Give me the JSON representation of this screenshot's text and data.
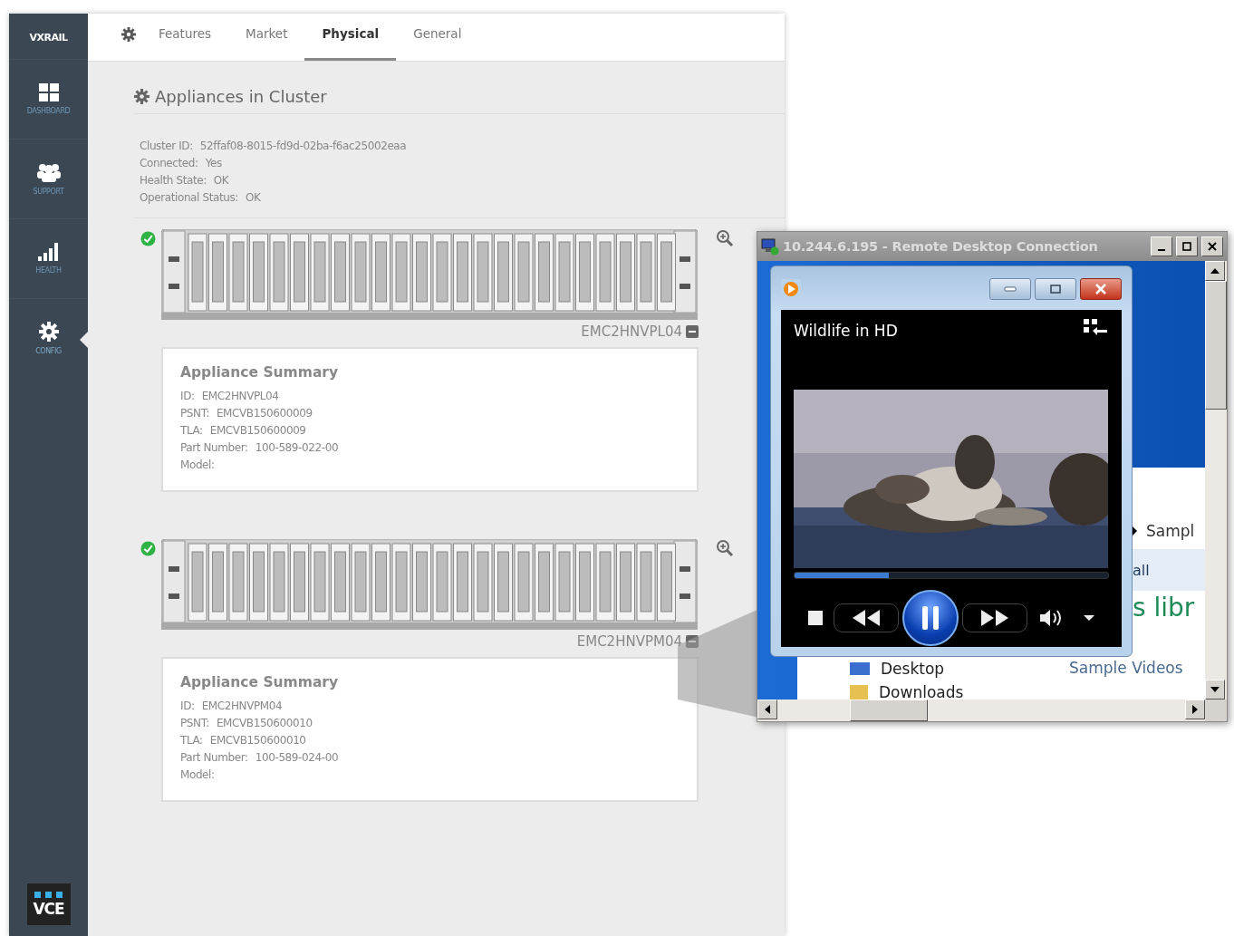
{
  "sidebar": {
    "logo": "VXRAIL",
    "items": [
      {
        "kind": "dashboard",
        "label": "DASHBOARD",
        "selected": false
      },
      {
        "kind": "support",
        "label": "SUPPORT",
        "selected": false
      },
      {
        "kind": "health",
        "label": "HEALTH",
        "selected": false
      },
      {
        "kind": "config",
        "label": "CONFIG",
        "selected": true
      }
    ],
    "footer_logo": "VCE"
  },
  "tabs": [
    {
      "label": "Features",
      "selected": false
    },
    {
      "label": "Market",
      "selected": false
    },
    {
      "label": "Physical",
      "selected": true
    },
    {
      "label": "General",
      "selected": false
    }
  ],
  "heading": "Appliances in Cluster",
  "cluster_info": [
    {
      "label": "Cluster ID:",
      "value": "52ffaf08-8015-fd9d-02ba-f6ac25002eaa"
    },
    {
      "label": "Connected:",
      "value": "Yes"
    },
    {
      "label": "Health State:",
      "value": "OK"
    },
    {
      "label": "Operational Status:",
      "value": "OK"
    }
  ],
  "appliances": [
    {
      "healthy": true,
      "name": "EMC2HNVPL04",
      "summary_title": "Appliance Summary",
      "fields": [
        {
          "label": "ID:",
          "value": "EMC2HNVPL04"
        },
        {
          "label": "PSNT:",
          "value": "EMCVB150600009"
        },
        {
          "label": "TLA:",
          "value": "EMCVB150600009"
        },
        {
          "label": "Part Number:",
          "value": "100-589-022-00"
        },
        {
          "label": "Model:"
        }
      ]
    },
    {
      "healthy": true,
      "name": "EMC2HNVPM04",
      "summary_title": "Appliance Summary",
      "fields": [
        {
          "label": "ID:",
          "value": "EMC2HNVPM04"
        },
        {
          "label": "PSNT:",
          "value": "EMCVB150600010"
        },
        {
          "label": "TLA:",
          "value": "EMCVB150600010"
        },
        {
          "label": "Part Number:",
          "value": "100-589-024-00"
        },
        {
          "label": "Model:"
        }
      ]
    }
  ],
  "remote_desktop": {
    "title": "10.244.6.195 - Remote Desktop Connection",
    "explorer": {
      "breadcrumb": "Sampl",
      "toolbar": [
        "all"
      ],
      "library_title": "s libr",
      "library_subtitle": "Sample Videos",
      "folders": [
        "Desktop",
        "Downloads"
      ]
    },
    "player": {
      "title": "Wildlife in HD",
      "progress": {
        "level": 0.3
      },
      "playing": true
    }
  }
}
